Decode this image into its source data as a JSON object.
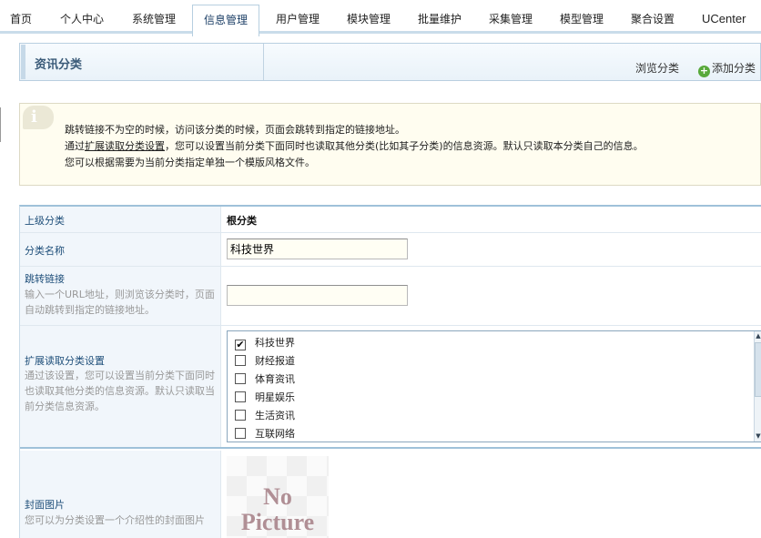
{
  "nav": {
    "tabs": [
      {
        "label": "首页"
      },
      {
        "label": "个人中心"
      },
      {
        "label": "系统管理"
      },
      {
        "label": "信息管理"
      },
      {
        "label": "用户管理"
      },
      {
        "label": "模块管理"
      },
      {
        "label": "批量维护"
      },
      {
        "label": "采集管理"
      },
      {
        "label": "模型管理"
      },
      {
        "label": "聚合设置"
      },
      {
        "label": "UCenter"
      }
    ],
    "active": "信息管理"
  },
  "header": {
    "title": "资讯分类",
    "browse_label": "浏览分类",
    "add_label": "添加分类",
    "add_icon": "plus-circle-icon"
  },
  "notice": {
    "icon": "info-icon",
    "icon_glyph": "i",
    "line1": "跳转链接不为空的时候，访问该分类的时候，页面会跳转到指定的链接地址。",
    "line2_pre": "通过",
    "line2_link": "扩展读取分类设置",
    "line2_post": "，您可以设置当前分类下面同时也读取其他分类(比如其子分类)的信息资源。默认只读取本分类自己的信息。",
    "line3": "您可以根据需要为当前分类指定单独一个模版风格文件。"
  },
  "form": {
    "parent": {
      "label": "上级分类",
      "value": "根分类"
    },
    "name": {
      "label": "分类名称",
      "value": "科技世界"
    },
    "link": {
      "label": "跳转链接",
      "desc": "输入一个URL地址，则浏览该分类时，页面自动跳转到指定的链接地址。",
      "value": ""
    },
    "extend": {
      "label": "扩展读取分类设置",
      "desc": "通过该设置，您可以设置当前分类下面同时也读取其他分类的信息资源。默认只读取当前分类信息资源。",
      "options": [
        {
          "label": "科技世界",
          "checked": true,
          "mark": "✔"
        },
        {
          "label": "财经报道",
          "checked": false,
          "mark": ""
        },
        {
          "label": "体育资讯",
          "checked": false,
          "mark": ""
        },
        {
          "label": "明星娱乐",
          "checked": false,
          "mark": ""
        },
        {
          "label": "生活资讯",
          "checked": false,
          "mark": ""
        },
        {
          "label": "互联网络",
          "checked": false,
          "mark": ""
        }
      ]
    },
    "cover": {
      "label": "封面图片",
      "desc": "您可以为分类设置一个介绍性的封面图片",
      "placeholder_line1": "No",
      "placeholder_line2": "Picture"
    }
  },
  "colors": {
    "label_text": "#1f4f7a",
    "label_bg": "#f1f6fb",
    "notice_bg": "#fffdf0",
    "nav_rule": "#c9dcea",
    "add_icon": "#58a93b"
  }
}
